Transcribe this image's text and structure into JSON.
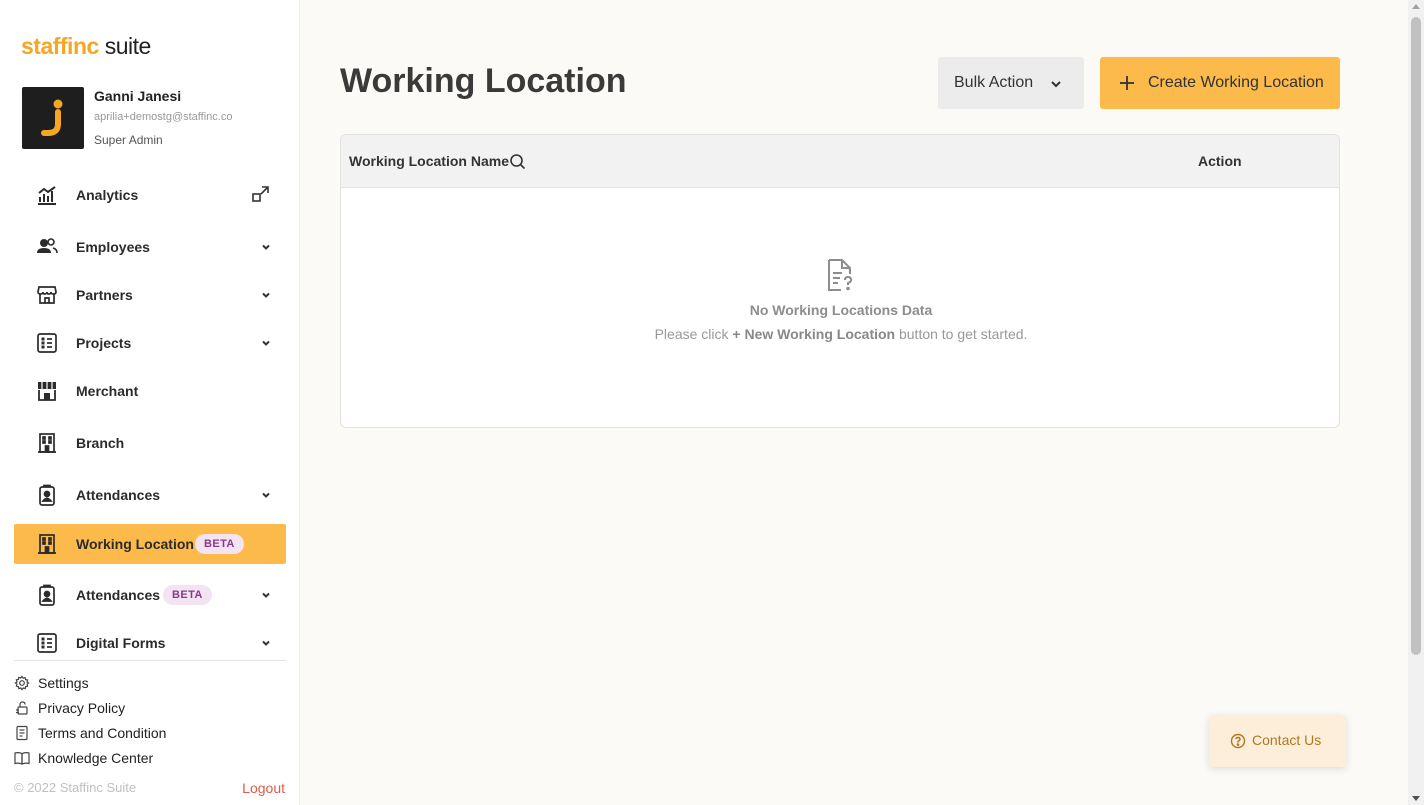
{
  "brand": {
    "logo_prefix": "staffinc",
    "logo_suffix": "suite",
    "accent_color": "#fcba4a"
  },
  "user": {
    "name": "Ganni Janesi",
    "email": "aprilia+demostg@staffinc.co",
    "role": "Super Admin"
  },
  "sidebar": {
    "items": [
      {
        "label": "Analytics",
        "icon": "analytics-icon",
        "trailing": "external-link-icon"
      },
      {
        "label": "Employees",
        "icon": "users-icon",
        "trailing": "chevron-down-icon"
      },
      {
        "label": "Partners",
        "icon": "store-icon",
        "trailing": "chevron-down-icon"
      },
      {
        "label": "Projects",
        "icon": "list-icon",
        "trailing": "chevron-down-icon"
      },
      {
        "label": "Merchant",
        "icon": "merchant-icon"
      },
      {
        "label": "Branch",
        "icon": "building-icon"
      },
      {
        "label": "Attendances",
        "icon": "badge-icon",
        "trailing": "chevron-down-icon"
      },
      {
        "label": "Working Location",
        "icon": "building-icon",
        "badge": "BETA",
        "active": true
      },
      {
        "label": "Attendances",
        "icon": "badge-icon",
        "badge": "BETA",
        "trailing": "chevron-down-icon"
      },
      {
        "label": "Digital Forms",
        "icon": "list-icon",
        "trailing": "chevron-down-icon"
      }
    ],
    "footer_links": [
      {
        "label": "Settings",
        "icon": "gear-icon"
      },
      {
        "label": "Privacy Policy",
        "icon": "privacy-icon"
      },
      {
        "label": "Terms and Condition",
        "icon": "document-icon"
      },
      {
        "label": "Knowledge Center",
        "icon": "book-icon"
      }
    ],
    "copyright": "© 2022 Staffinc Suite",
    "logout_label": "Logout"
  },
  "main": {
    "title": "Working Location",
    "bulk_action_label": "Bulk Action",
    "create_label": "Create Working Location",
    "table": {
      "columns": [
        "Working Location Name",
        "Action"
      ],
      "empty_title": "No Working Locations Data",
      "empty_sub_before": "Please click ",
      "empty_sub_bold": "+ New Working Location",
      "empty_sub_after": " button to get started."
    }
  },
  "contact_label": "Contact Us"
}
